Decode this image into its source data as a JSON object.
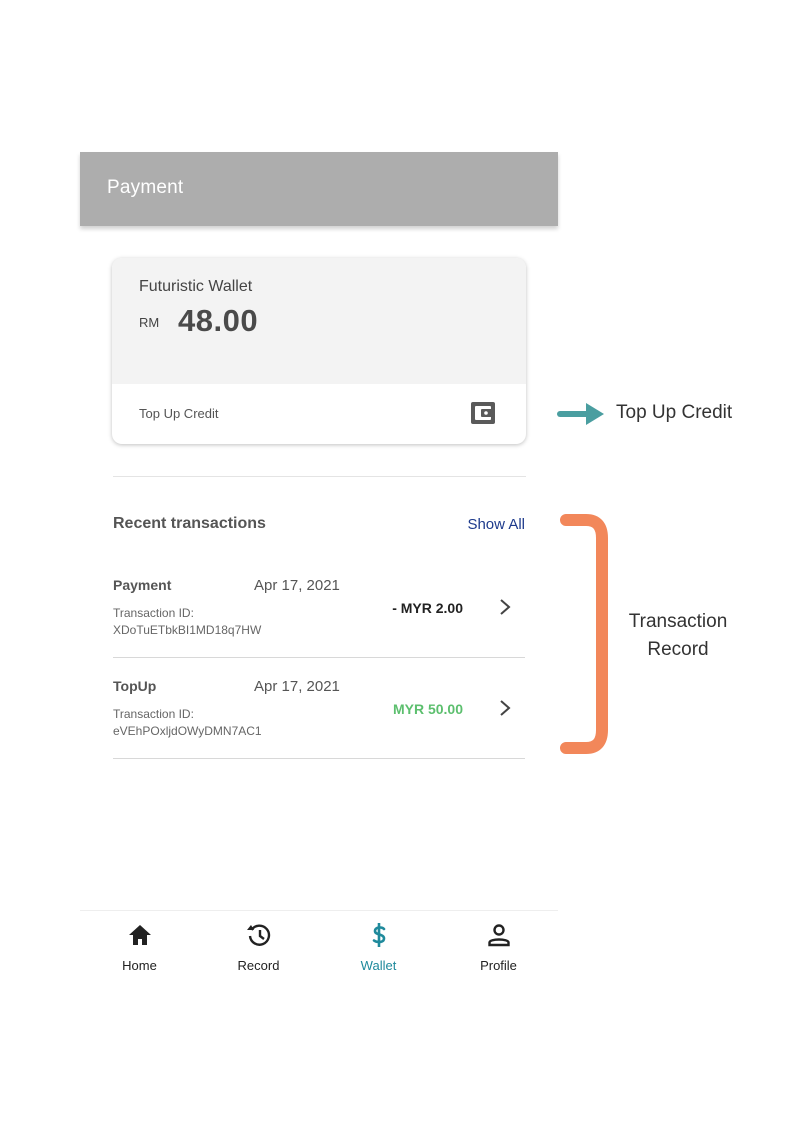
{
  "app_bar": {
    "title": "Payment"
  },
  "wallet": {
    "name": "Futuristic Wallet",
    "currency": "RM",
    "balance": "48.00",
    "top_up_label": "Top Up Credit",
    "icon": "wallet-icon"
  },
  "transactions": {
    "title": "Recent transactions",
    "show_all_label": "Show All",
    "items": [
      {
        "type": "Payment",
        "date": "Apr 17, 2021",
        "id_label": "Transaction ID:",
        "id": "XDoTuETbkBI1MD18q7HW",
        "amount": "- MYR 2.00",
        "amount_color": "#222222"
      },
      {
        "type": "TopUp",
        "date": "Apr 17, 2021",
        "id_label": "Transaction ID:",
        "id": "eVEhPOxljdOWyDMN7AC1",
        "amount": "MYR 50.00",
        "amount_color": "#5cbf6e"
      }
    ]
  },
  "bottom_nav": {
    "active_color": "#1f8a9c",
    "items": [
      {
        "label": "Home",
        "icon": "home-icon",
        "active": false
      },
      {
        "label": "Record",
        "icon": "history-icon",
        "active": false
      },
      {
        "label": "Wallet",
        "icon": "dollar-icon",
        "active": true
      },
      {
        "label": "Profile",
        "icon": "profile-icon",
        "active": false
      }
    ]
  },
  "annotations": {
    "top_up": "Top Up Credit",
    "transaction_line1": "Transaction",
    "transaction_line2": "Record",
    "arrow_color": "#4a9ea0",
    "bracket_color": "#f2875a"
  }
}
